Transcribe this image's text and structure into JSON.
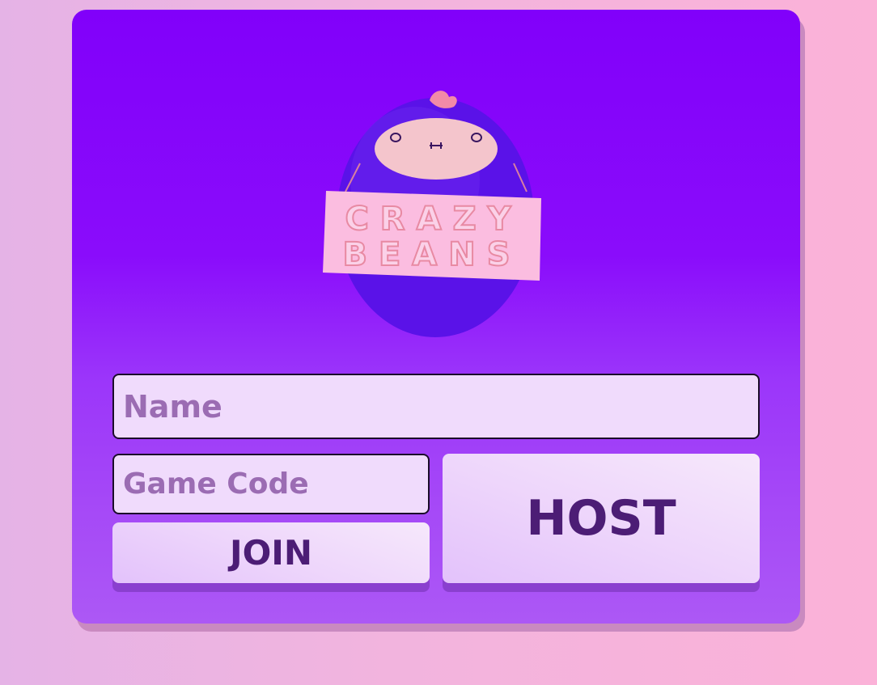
{
  "logo": {
    "line1": "CRAZY",
    "line2": "BEANS"
  },
  "form": {
    "name_placeholder": "Name",
    "name_value": "",
    "code_placeholder": "Game Code",
    "code_value": ""
  },
  "buttons": {
    "join_label": "JOIN",
    "host_label": "HOST"
  },
  "colors": {
    "card_top": "#8100fa",
    "card_bottom": "#ac58f5",
    "input_bg": "#f0dbfc",
    "button_text": "#4c1d75",
    "bean_body": "#5a12e8",
    "sign_bg": "#fbbde0"
  },
  "icons": {
    "mascot": "bean-mascot-icon"
  }
}
